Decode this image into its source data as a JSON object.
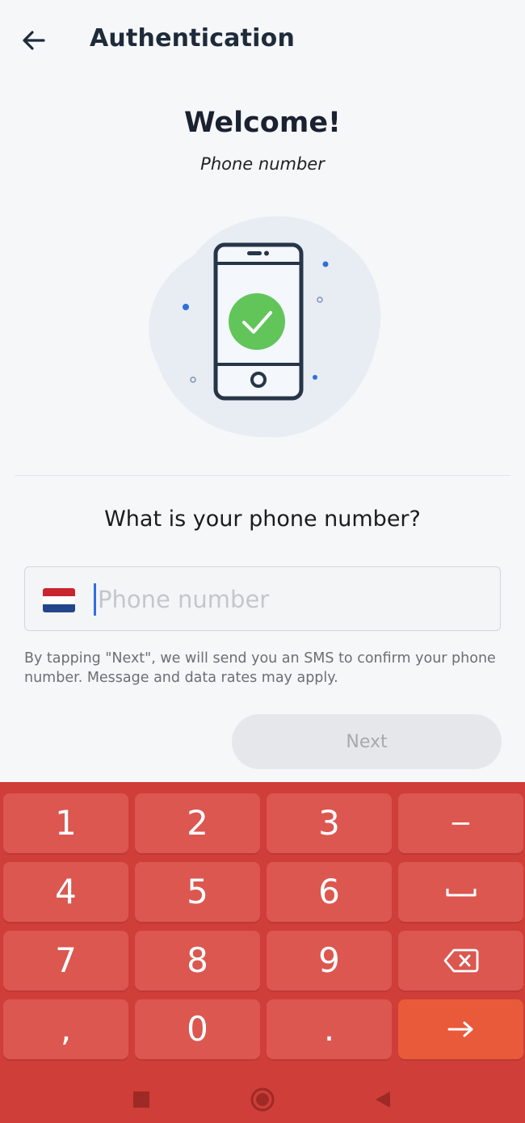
{
  "appbar": {
    "title": "Authentication",
    "back_icon": "arrow-left-icon"
  },
  "header": {
    "welcome": "Welcome!",
    "subtitle": "Phone number"
  },
  "illustration": {
    "icon": "phone-check-icon",
    "accent_color": "#62c55a"
  },
  "form": {
    "question": "What is your phone number?",
    "country_flag": "netherlands-flag-icon",
    "phone_placeholder": "Phone number",
    "phone_value": "",
    "disclaimer": "By tapping \"Next\", we will send you an SMS to confirm your phone number. Message and data rates may apply.",
    "next_label": "Next"
  },
  "keyboard": {
    "colors": {
      "background": "#cf3e38",
      "key": "#db5750",
      "action_key": "#e85a3a"
    },
    "rows": [
      [
        "1",
        "2",
        "3",
        "−"
      ],
      [
        "4",
        "5",
        "6",
        "space-icon"
      ],
      [
        "7",
        "8",
        "9",
        "backspace-icon"
      ],
      [
        ",",
        "0",
        ".",
        "enter-arrow-icon"
      ]
    ],
    "keys": {
      "k1": "1",
      "k2": "2",
      "k3": "3",
      "dash": "−",
      "k4": "4",
      "k5": "5",
      "k6": "6",
      "k7": "7",
      "k8": "8",
      "k9": "9",
      "comma": ",",
      "k0": "0",
      "period": "."
    }
  },
  "navbar": {
    "recents": "square-icon",
    "home": "circle-icon",
    "back": "triangle-back-icon"
  }
}
